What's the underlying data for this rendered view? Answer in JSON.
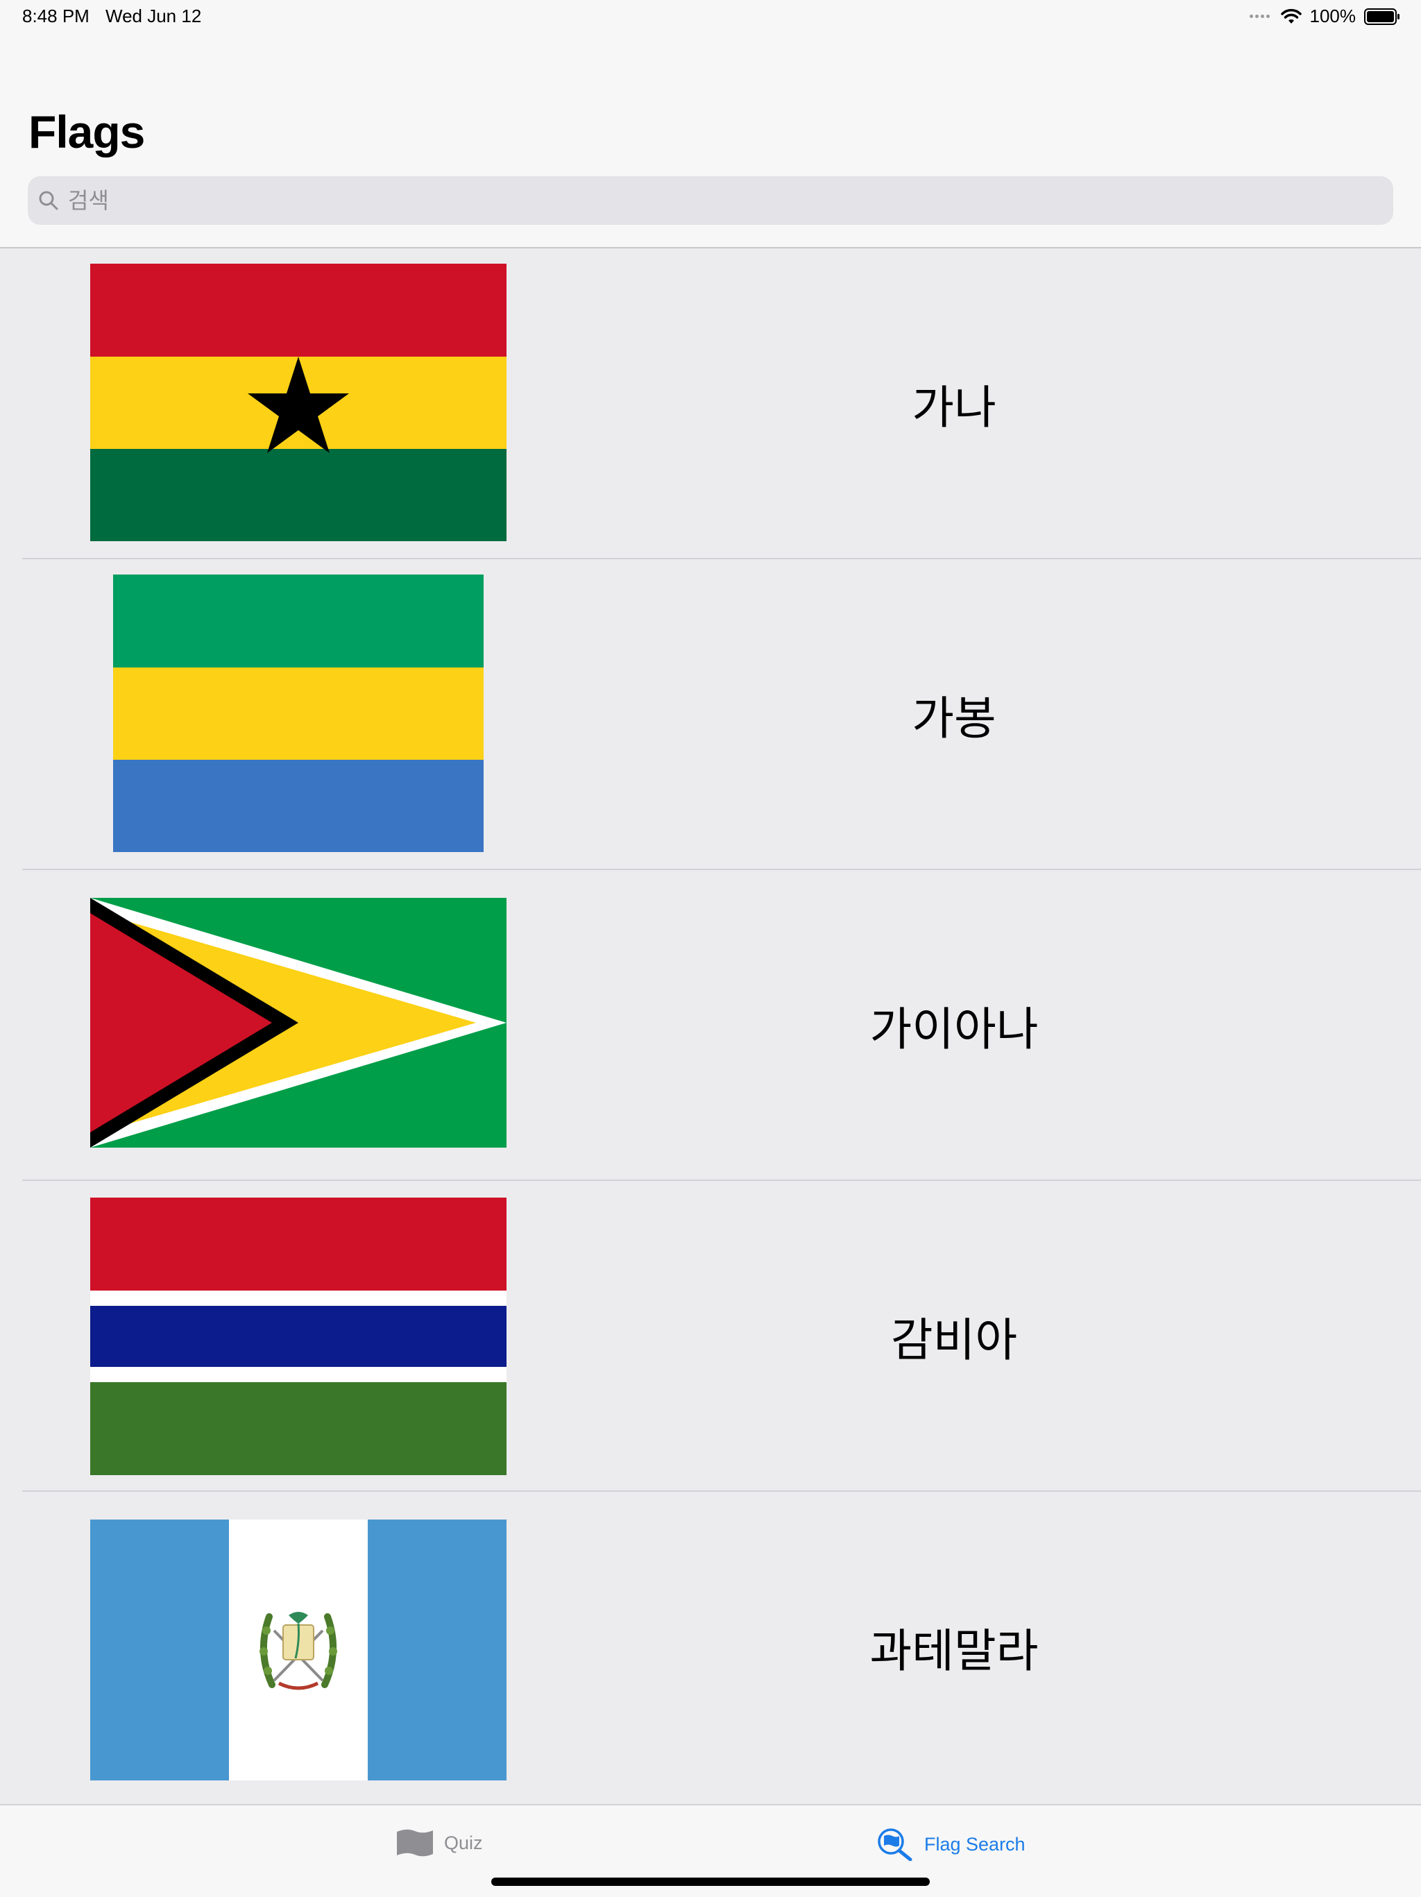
{
  "status": {
    "time": "8:48 PM",
    "date": "Wed Jun 12",
    "battery": "100%"
  },
  "nav": {
    "title": "Flags"
  },
  "search": {
    "placeholder": "검색"
  },
  "countries": [
    {
      "name": "가나",
      "flag": "ghana"
    },
    {
      "name": "가봉",
      "flag": "gabon"
    },
    {
      "name": "가이아나",
      "flag": "guyana"
    },
    {
      "name": "감비아",
      "flag": "gambia"
    },
    {
      "name": "과테말라",
      "flag": "guatemala"
    }
  ],
  "tabs": [
    {
      "label": "Quiz",
      "icon": "flag-icon",
      "selected": false
    },
    {
      "label": "Flag Search",
      "icon": "flag-search-icon",
      "selected": true
    }
  ],
  "colors": {
    "accent": "#1b7ce8",
    "inactive": "#8e8e93"
  }
}
